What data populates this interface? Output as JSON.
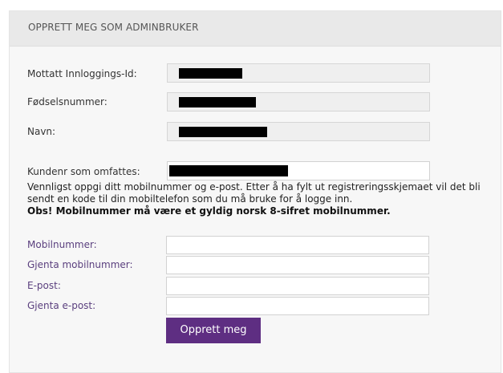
{
  "panel": {
    "title": "OPPRETT MEG SOM ADMINBRUKER"
  },
  "readonly_fields": [
    {
      "label": "Mottatt Innloggings-Id:",
      "value_redacted": true
    },
    {
      "label": "Fødselsnummer:",
      "value_redacted": true
    },
    {
      "label": "Navn:",
      "value_redacted": true
    }
  ],
  "customer": {
    "label": "Kundenr som omfattes:",
    "value_redacted": true
  },
  "info": {
    "text": "Vennligst oppgi ditt mobilnummer og e-post. Etter å ha fylt ut registreringsskjemaet vil det bli sendt en kode til din mobiltelefon som du må bruke for å logge inn.",
    "warning": "Obs! Mobilnummer må være et gyldig norsk 8-sifret mobilnummer."
  },
  "form": {
    "mobile_label": "Mobilnummer:",
    "mobile_repeat_label": "Gjenta mobilnummer:",
    "email_label": "E-post:",
    "email_repeat_label": "Gjenta e-post:",
    "mobile_value": "",
    "mobile_repeat_value": "",
    "email_value": "",
    "email_repeat_value": ""
  },
  "submit_label": "Opprett meg",
  "colors": {
    "accent": "#5e2e82",
    "label_purple": "#5a3f7e",
    "panel_bg": "#f7f7f7",
    "header_bg": "#e9e9e9"
  }
}
